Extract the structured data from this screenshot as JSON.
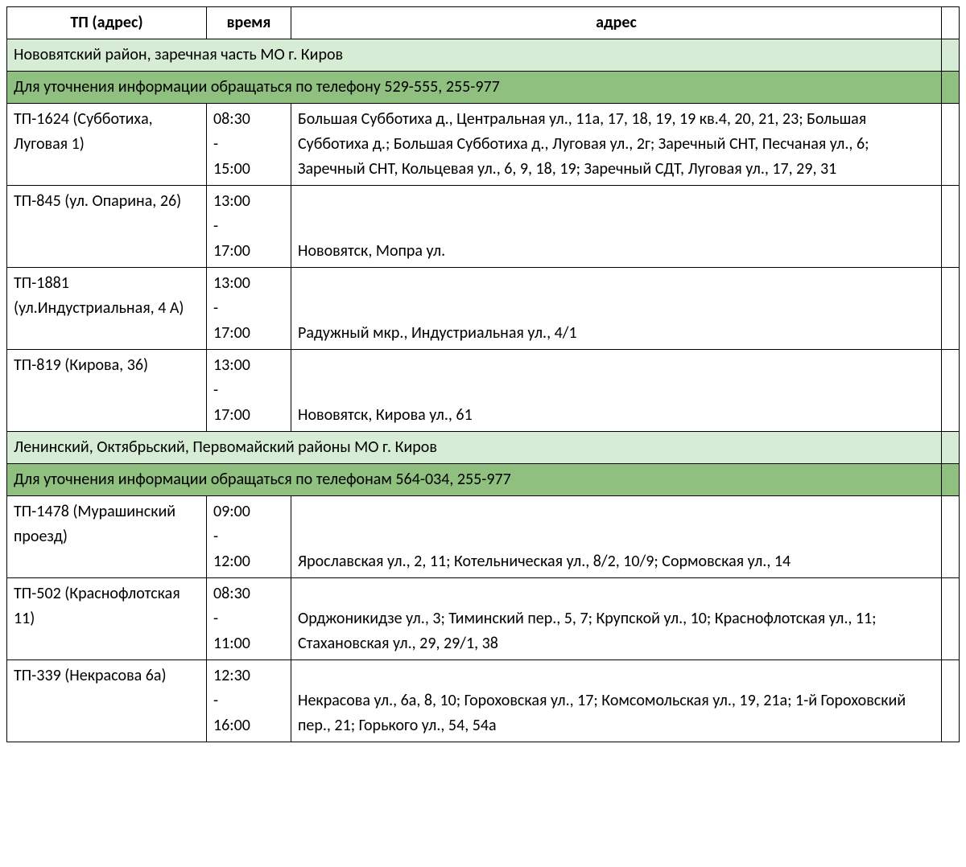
{
  "headers": {
    "tp": "ТП (адрес)",
    "time": "время",
    "addr": "адрес"
  },
  "sections": [
    {
      "district": "Нововятский район, заречная часть МО г. Киров",
      "contact": "Для уточнения информации обращаться по телефону 529-555, 255-977",
      "rows": [
        {
          "tp": "ТП-1624 (Субботиха, Луговая 1)",
          "time_from": "08:30",
          "time_to": "15:00",
          "addr": "Большая Субботиха д., Центральная ул., 11а, 17, 18, 19, 19 кв.4, 20, 21, 23; Большая Субботиха д.; Большая Субботиха д., Луговая ул., 2г; Заречный СНТ, Песчаная ул., 6; Заречный СНТ, Кольцевая ул., 6, 9, 18, 19; Заречный СДТ, Луговая ул., 17, 29, 31"
        },
        {
          "tp": "ТП-845 (ул. Опарина, 26)",
          "time_from": "13:00",
          "time_to": "17:00",
          "addr": "Нововятск, Мопра ул."
        },
        {
          "tp": "ТП-1881 (ул.Индустриальная, 4 А)",
          "time_from": "13:00",
          "time_to": "17:00",
          "addr": "Радужный мкр., Индустриальная ул., 4/1"
        },
        {
          "tp": "ТП-819 (Кирова, 36)",
          "time_from": "13:00",
          "time_to": "17:00",
          "addr": "Нововятск, Кирова ул., 61"
        }
      ]
    },
    {
      "district": "Ленинский, Октябрьский, Первомайский районы МО г. Киров",
      "contact": "Для уточнения информации обращаться по телефонам 564-034, 255-977",
      "rows": [
        {
          "tp": "ТП-1478 (Мурашинский проезд)",
          "time_from": "09:00",
          "time_to": "12:00",
          "addr": "Ярославская ул., 2, 11; Котельническая ул., 8/2, 10/9; Сормовская ул., 14"
        },
        {
          "tp": "ТП-502 (Краснофлотская 11)",
          "time_from": "08:30",
          "time_to": "11:00",
          "addr": "Орджоникидзе ул., 3; Тиминский пер., 5, 7; Крупской ул., 10; Краснофлотская ул., 11; Стахановская ул., 29, 29/1, 38"
        },
        {
          "tp": "ТП-339 (Некрасова 6а)",
          "time_from": "12:30",
          "time_to": "16:00",
          "addr": "Некрасова ул., 6а, 8, 10; Гороховская ул., 17; Комсомольская ул., 19, 21а; 1-й Гороховский пер., 21; Горького ул., 54, 54а"
        }
      ]
    }
  ]
}
